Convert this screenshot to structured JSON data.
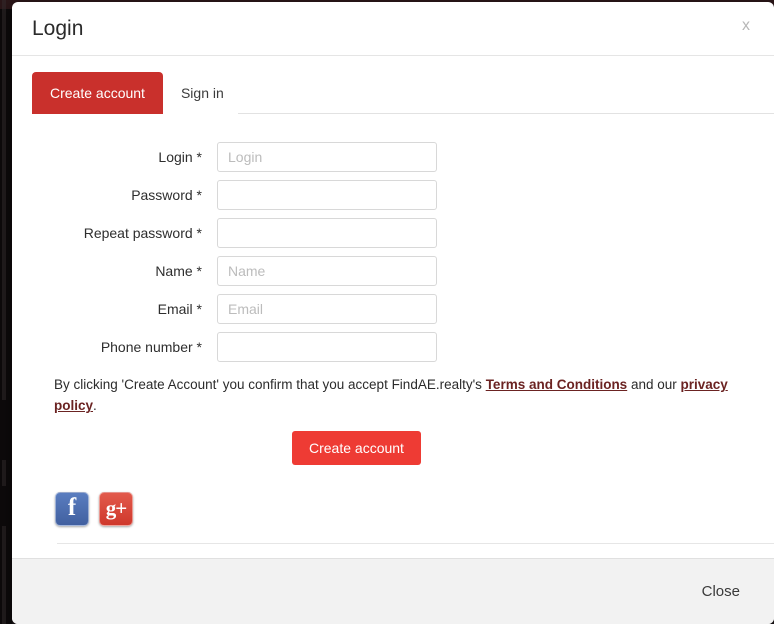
{
  "modal": {
    "title": "Login",
    "close_icon": "close-x-icon",
    "close_icon_glyph": "x"
  },
  "tabs": [
    {
      "label": "Create account",
      "active": true
    },
    {
      "label": "Sign in",
      "active": false
    }
  ],
  "form": {
    "fields": [
      {
        "label": "Login *",
        "placeholder": "Login",
        "value": "",
        "type": "text"
      },
      {
        "label": "Password *",
        "placeholder": "",
        "value": "",
        "type": "password"
      },
      {
        "label": "Repeat password *",
        "placeholder": "",
        "value": "",
        "type": "password"
      },
      {
        "label": "Name *",
        "placeholder": "Name",
        "value": "",
        "type": "text"
      },
      {
        "label": "Email *",
        "placeholder": "Email",
        "value": "",
        "type": "text"
      },
      {
        "label": "Phone number *",
        "placeholder": "",
        "value": "",
        "type": "text"
      }
    ]
  },
  "legal": {
    "before_terms": "By clicking 'Create Account' you confirm that you accept FindAE.realty's ",
    "terms_link": "Terms and Conditions",
    "between": " and our ",
    "privacy_link": "privacy policy",
    "after": "."
  },
  "submit": {
    "label": "Create account"
  },
  "social": [
    {
      "name": "facebook",
      "glyph": "f",
      "color": "#4160a0"
    },
    {
      "name": "google-plus",
      "glyph": "g+",
      "color": "#cf382c"
    }
  ],
  "footer": {
    "close_label": "Close"
  },
  "colors": {
    "tab_active": "#c9302c",
    "submit_button": "#ee3b34",
    "link": "#6b2322",
    "footer_bg": "#f2f2f2",
    "input_border": "#d8d8d8",
    "placeholder": "#bcbcbc"
  }
}
